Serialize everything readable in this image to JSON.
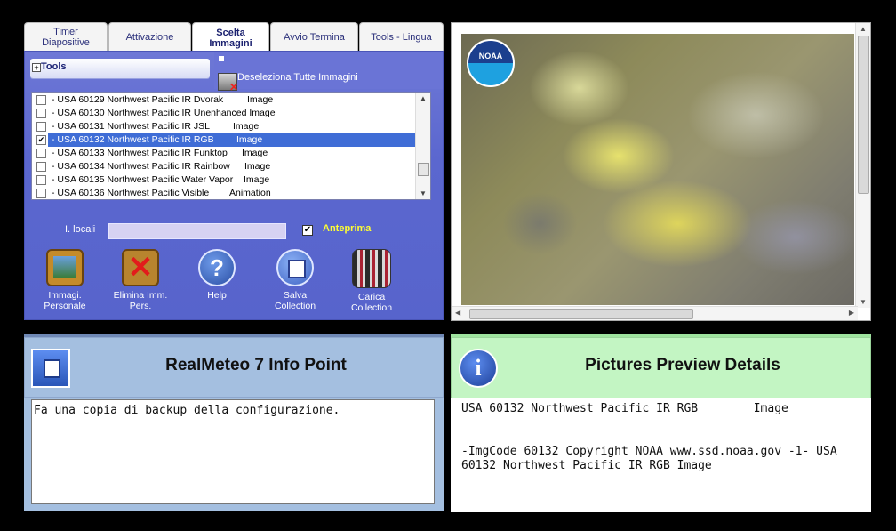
{
  "tabs": [
    {
      "label": "Timer\nDiapositive"
    },
    {
      "label": "Attivazione"
    },
    {
      "label": "Scelta\nImmagini"
    },
    {
      "label": "Avvio Termina"
    },
    {
      "label": "Tools - Lingua"
    }
  ],
  "tools": {
    "label": "Tools",
    "deselect_label": "Deseleziona Tutte Immagini"
  },
  "list": {
    "items": [
      {
        "name": "- USA 60129 Northwest Pacific IR Dvorak",
        "kind": "Image",
        "checked": false
      },
      {
        "name": "- USA 60130 Northwest Pacific IR Unenhanced Image",
        "kind": "",
        "checked": false
      },
      {
        "name": "- USA 60131 Northwest Pacific IR JSL",
        "kind": "Image",
        "checked": false
      },
      {
        "name": "- USA 60132 Northwest Pacific IR RGB",
        "kind": "Image",
        "checked": true
      },
      {
        "name": "- USA 60133 Northwest Pacific IR Funktop",
        "kind": "Image",
        "checked": false
      },
      {
        "name": "- USA 60134 Northwest Pacific IR Rainbow",
        "kind": "Image",
        "checked": false
      },
      {
        "name": "- USA 60135 Northwest Pacific Water Vapor",
        "kind": "Image",
        "checked": false
      },
      {
        "name": "- USA 60136 Northwest Pacific Visible",
        "kind": "Animation",
        "checked": false
      }
    ]
  },
  "local": {
    "label": "I. locali",
    "value": "",
    "preview_label": "Anteprima",
    "preview_checked": true
  },
  "buttons": {
    "personal": "Immagi.\nPersonale",
    "delete": "Elimina Imm.\nPers.",
    "help": "Help",
    "save": "Salva\nCollection",
    "load": "Carica\nCollection"
  },
  "map": {
    "logo_text": "NOAA"
  },
  "info": {
    "title": "RealMeteo 7 Info Point",
    "text": "Fa una copia di backup della configurazione."
  },
  "preview": {
    "title": "Pictures Preview Details",
    "line1": "USA 60132 Northwest Pacific IR RGB        Image",
    "line2": "-ImgCode 60132 Copyright NOAA www.ssd.noaa.gov -1- USA 60132 Northwest Pacific IR RGB        Image"
  },
  "colors": {
    "panel_blue": "#5b67cf",
    "selection": "#3f6dd6",
    "info_header": "#a4bfe0",
    "preview_header": "#c3f5c3",
    "anteprima": "#ffff33"
  }
}
